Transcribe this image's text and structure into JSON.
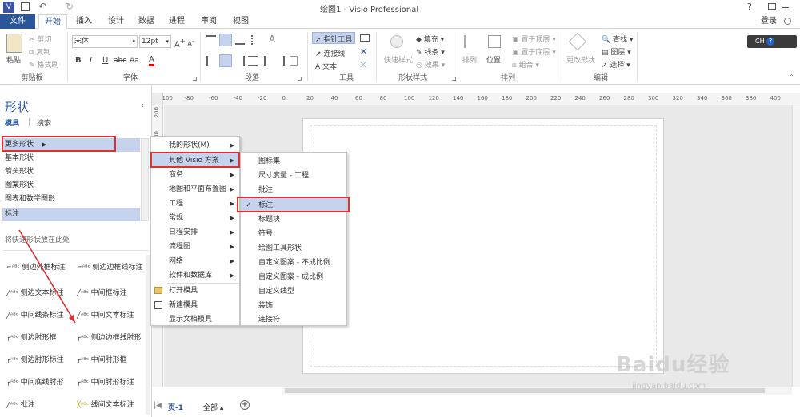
{
  "titlebar": {
    "title": "绘图1 - Visio Professional",
    "help": "?",
    "app_icon": "V"
  },
  "tabs": {
    "file": "文件",
    "home": "开始",
    "insert": "插入",
    "design": "设计",
    "data": "数据",
    "process": "进程",
    "review": "审阅",
    "view": "视图",
    "login": "登录"
  },
  "ribbon": {
    "clipboard": {
      "label": "剪贴板",
      "paste": "粘贴",
      "cut": "剪切",
      "copy": "复制",
      "format_painter": "格式刷"
    },
    "font": {
      "label": "字体",
      "family": "宋体",
      "size": "12pt"
    },
    "paragraph": {
      "label": "段落"
    },
    "tools": {
      "label": "工具",
      "pointer": "指针工具",
      "connector": "连接线",
      "text": "文本"
    },
    "shape_styles": {
      "label": "形状样式",
      "quick": "快速样式",
      "fill": "填充",
      "line": "线条",
      "effects": "效果"
    },
    "arrange": {
      "label": "排列",
      "align": "排列",
      "position": "位置",
      "front": "置于顶层",
      "back": "置于底层",
      "group": "组合"
    },
    "editing": {
      "label": "编辑",
      "change_shape": "更改形状",
      "find": "查找",
      "layers": "图层",
      "select": "选择"
    },
    "ime": "CH"
  },
  "shapes": {
    "title": "形状",
    "tab_stencils": "模具",
    "tab_search": "搜索",
    "more_shapes": "更多形状",
    "categories": [
      "基本形状",
      "箭头形状",
      "图案形状",
      "图表和数学图形",
      "标注"
    ],
    "drop_hint": "将快速形状放在此处",
    "stencil_items": [
      "侧边外框标注",
      "侧边边框线标注",
      "侧边文本标注",
      "中间框标注",
      "中间线条标注",
      "中间文本标注",
      "侧边肘形框",
      "侧边边框线肘形",
      "侧边肘形标注",
      "中间肘形框",
      "中间底线肘形",
      "中间肘形标注",
      "批注",
      "线间文本标注"
    ]
  },
  "menu1": {
    "items": [
      "我的形状(M)",
      "其他 Visio 方案",
      "商务",
      "地图和平面布置图",
      "工程",
      "常规",
      "日程安排",
      "流程图",
      "网络",
      "软件和数据库"
    ],
    "actions": [
      "打开模具",
      "新建模具",
      "显示文档模具"
    ]
  },
  "menu2": {
    "items": [
      "图标集",
      "尺寸度量 - 工程",
      "批注",
      "标注",
      "标题块",
      "符号",
      "绘图工具形状",
      "自定义图案 - 不成比例",
      "自定义图案 - 成比例",
      "自定义线型",
      "装饰",
      "连接符"
    ],
    "checked": "标注"
  },
  "ruler": {
    "top_ticks": [
      "-100",
      "-80",
      "-60",
      "-40",
      "-20",
      "0",
      "20",
      "40",
      "60",
      "80",
      "100",
      "120",
      "140",
      "160",
      "180",
      "200",
      "220",
      "240",
      "260",
      "280",
      "300",
      "320",
      "340",
      "360",
      "380",
      "400"
    ],
    "left_ticks": [
      "200",
      "180",
      "160",
      "140",
      "120",
      "100"
    ]
  },
  "status": {
    "page": "页-1",
    "all": "全部"
  },
  "watermark": {
    "brand": "Baidu",
    "sub": "经验",
    "url": "jingyan.baidu.com"
  },
  "colors": {
    "accent": "#2b579a",
    "highlight": "#c5d3ee",
    "red": "#e03030"
  }
}
